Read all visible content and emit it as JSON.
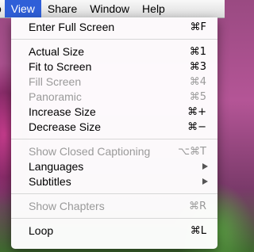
{
  "menubar": {
    "items": [
      {
        "label": "o"
      },
      {
        "label": "View"
      },
      {
        "label": "Share"
      },
      {
        "label": "Window"
      },
      {
        "label": "Help"
      }
    ]
  },
  "menu": {
    "groups": [
      [
        {
          "label": "Enter Full Screen",
          "shortcut": "⌘F",
          "disabled": false
        }
      ],
      [
        {
          "label": "Actual Size",
          "shortcut": "⌘1",
          "disabled": false
        },
        {
          "label": "Fit to Screen",
          "shortcut": "⌘3",
          "disabled": false
        },
        {
          "label": "Fill Screen",
          "shortcut": "⌘4",
          "disabled": true
        },
        {
          "label": "Panoramic",
          "shortcut": "⌘5",
          "disabled": true
        },
        {
          "label": "Increase Size",
          "shortcut": "⌘+",
          "disabled": false
        },
        {
          "label": "Decrease Size",
          "shortcut": "⌘−",
          "disabled": false
        }
      ],
      [
        {
          "label": "Show Closed Captioning",
          "shortcut": "⌥⌘T",
          "disabled": true
        },
        {
          "label": "Languages",
          "submenu": true,
          "disabled": false
        },
        {
          "label": "Subtitles",
          "submenu": true,
          "disabled": false
        }
      ],
      [
        {
          "label": "Show Chapters",
          "shortcut": "⌘R",
          "disabled": true
        }
      ],
      [
        {
          "label": "Loop",
          "shortcut": "⌘L",
          "disabled": false
        }
      ]
    ]
  }
}
